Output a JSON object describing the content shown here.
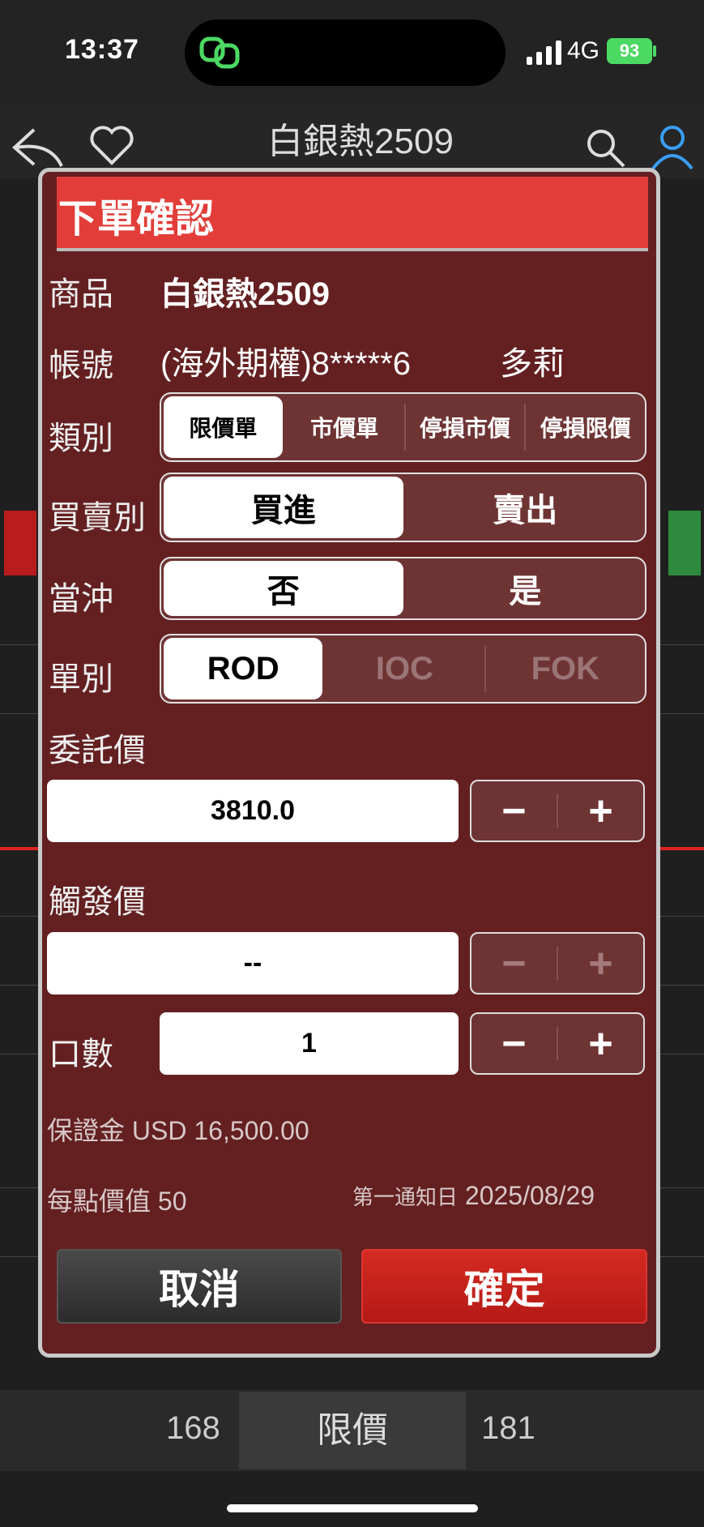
{
  "status": {
    "time": "13:37",
    "network": "4G",
    "battery": "93"
  },
  "background": {
    "title": "白銀熱2509",
    "bottom_left": "168",
    "bottom_center": "限價",
    "bottom_right": "181"
  },
  "dialog": {
    "title": "下單確認",
    "product": {
      "label": "商品",
      "value": "白銀熱2509"
    },
    "account": {
      "label": "帳號",
      "value": "(海外期權)8*****6",
      "name": "多莉"
    },
    "order_type": {
      "label": "類別",
      "options": [
        "限價單",
        "市價單",
        "停損市價",
        "停損限價"
      ],
      "selected": "限價單"
    },
    "side": {
      "label": "買賣別",
      "options": [
        "買進",
        "賣出"
      ],
      "selected": "買進"
    },
    "day_trade": {
      "label": "當沖",
      "options": [
        "否",
        "是"
      ],
      "selected": "否"
    },
    "tif": {
      "label": "單別",
      "options": [
        "ROD",
        "IOC",
        "FOK"
      ],
      "selected": "ROD"
    },
    "price": {
      "label": "委託價",
      "value": "3810.0"
    },
    "trigger": {
      "label": "觸發價",
      "value": "--"
    },
    "qty": {
      "label": "口數",
      "value": "1"
    },
    "margin": {
      "label": "保證金",
      "currency": "USD",
      "value": "16,500.00"
    },
    "point_value": {
      "label": "每點價值",
      "value": "50"
    },
    "first_notice": {
      "label": "第一通知日",
      "value": "2025/08/29"
    },
    "cancel_label": "取消",
    "confirm_label": "確定",
    "minus": "−",
    "plus": "+"
  },
  "colors": {
    "header": "#e23d38",
    "dialog_bg": "#642021",
    "confirm": "#c4211b"
  }
}
